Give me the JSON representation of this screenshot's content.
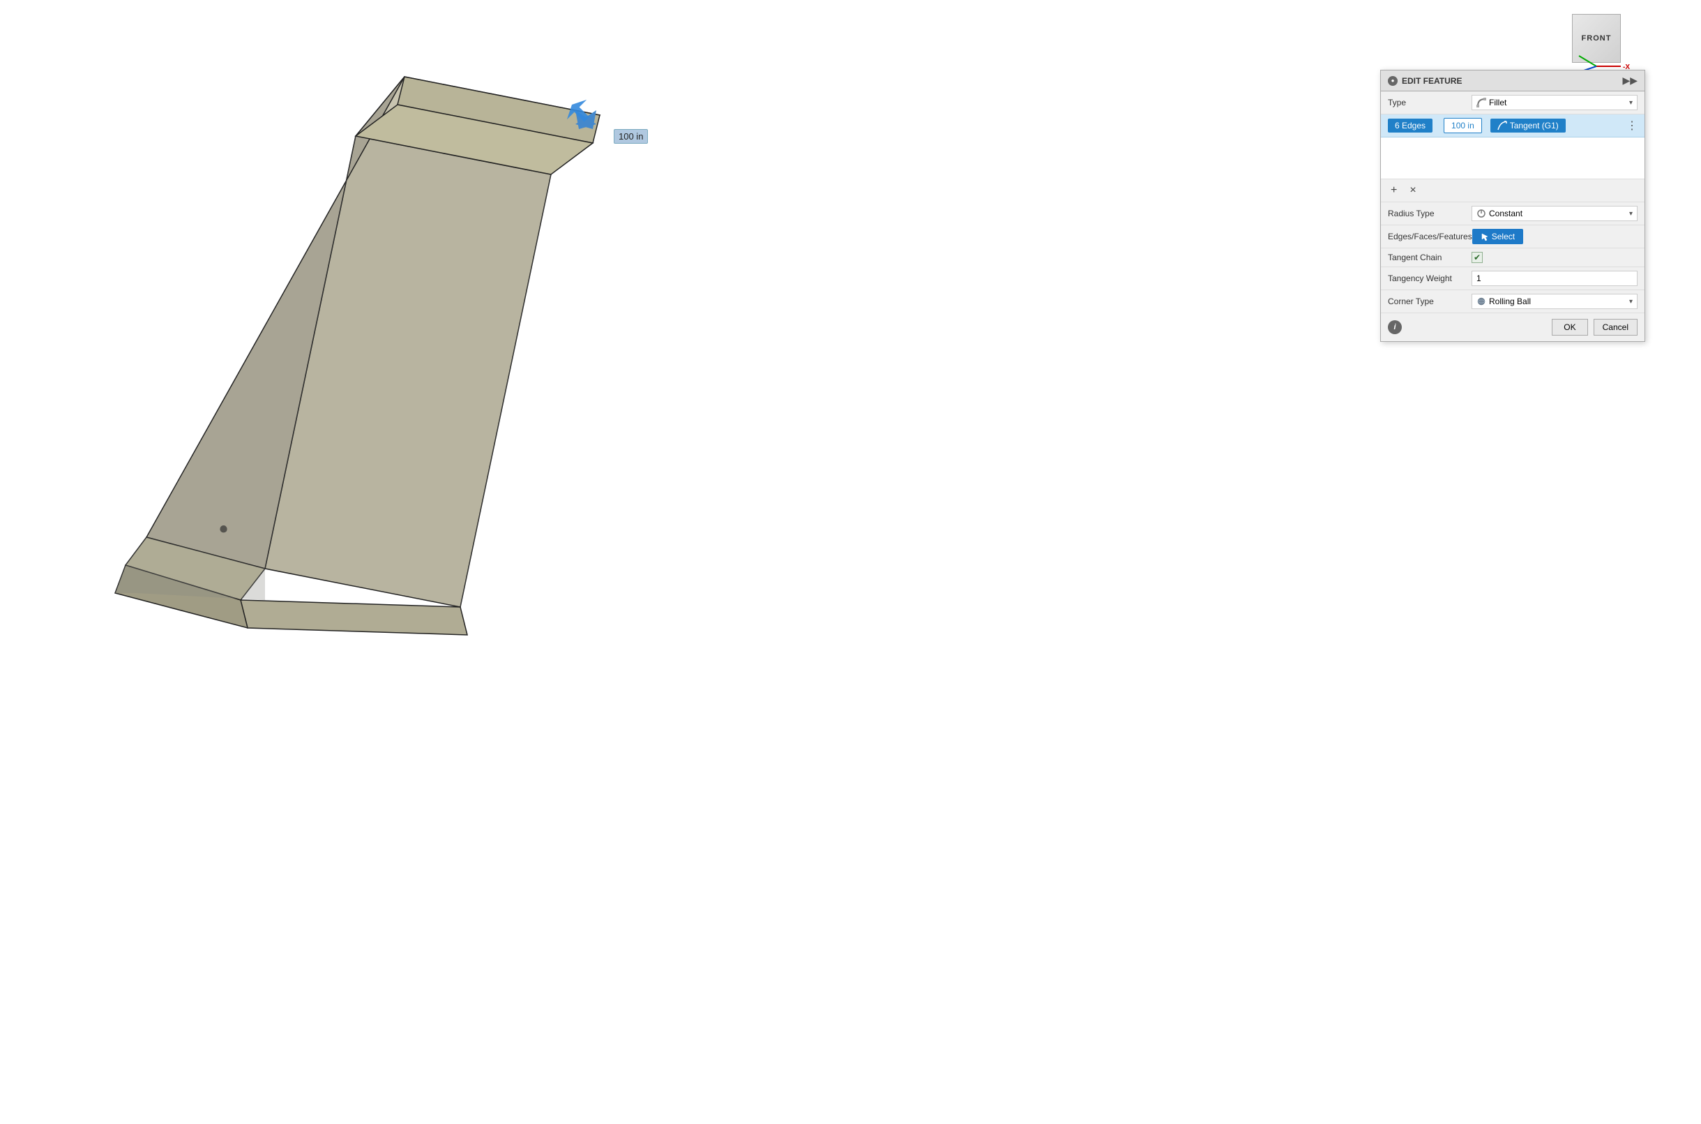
{
  "viewport": {
    "background": "#ffffff"
  },
  "nav_cube": {
    "label": "FRONT",
    "x_axis_label": "-X"
  },
  "dimension_label": "100 in",
  "panel": {
    "header": {
      "title": "EDIT FEATURE",
      "icon": "●",
      "expand_icon": "▶▶"
    },
    "type_row": {
      "label": "Type",
      "value": "Fillet",
      "icon": "fillet-icon",
      "chevron": "▾"
    },
    "edges_row": {
      "label": "6 Edges",
      "value1": "100 in",
      "value2": "Tangent (G1)",
      "dots": "⋮"
    },
    "actions": {
      "add": "+",
      "remove": "×"
    },
    "radius_type_row": {
      "label": "Radius Type",
      "value": "Constant",
      "chevron": "▾"
    },
    "edges_faces_row": {
      "label": "Edges/Faces/Features",
      "button_label": "Select"
    },
    "tangent_chain_row": {
      "label": "Tangent Chain",
      "checked": true
    },
    "tangency_weight_row": {
      "label": "Tangency Weight",
      "value": "1"
    },
    "corner_type_row": {
      "label": "Corner Type",
      "value": "Rolling Ball",
      "chevron": "▾"
    },
    "footer": {
      "info_icon": "i",
      "ok_label": "OK",
      "cancel_label": "Cancel"
    }
  }
}
